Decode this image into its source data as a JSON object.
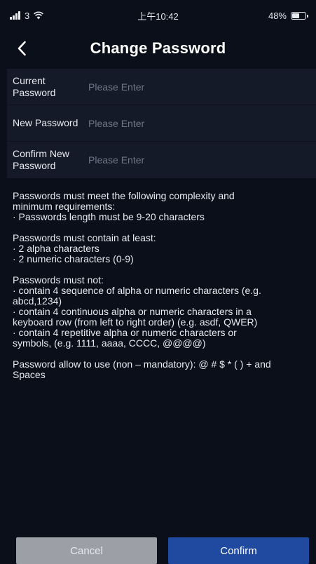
{
  "status_bar": {
    "carrier": "3",
    "time": "上午10:42",
    "battery_text": "48%",
    "battery_level": 0.48
  },
  "header": {
    "back_icon": "chevron-left-icon",
    "title": "Change Password"
  },
  "form": {
    "current_label": "Current Password",
    "current_placeholder": "Please Enter",
    "new_label": "New Password",
    "new_placeholder": "Please Enter",
    "confirm_label": "Confirm New Password",
    "confirm_placeholder": "Please Enter"
  },
  "requirements": {
    "block1": [
      "Passwords must meet the following complexity and",
      "minimum requirements:",
      "· Passwords length must be 9-20 characters"
    ],
    "block2": [
      "Passwords must contain at least:",
      "· 2 alpha characters",
      "· 2 numeric characters (0-9)"
    ],
    "block3": [
      "Passwords must not:",
      "· contain 4 sequence of alpha or numeric characters (e.g.",
      "abcd,1234)",
      "· contain 4 continuous alpha or numeric characters in a",
      "keyboard row (from left to right order) (e.g. asdf, QWER)",
      "· contain 4 repetitive alpha or numeric characters or",
      "symbols, (e.g. 1111, aaaa, CCCC, @@@@)"
    ],
    "block4": [
      "Password allow to use (non – mandatory): @ # $ * ( ) + and",
      "Spaces"
    ]
  },
  "buttons": {
    "cancel_label": "Cancel",
    "confirm_label": "Confirm"
  },
  "colors": {
    "background": "#0b0f1a",
    "form_background": "#141a27",
    "cancel_button": "#9c9fa6",
    "confirm_button": "#1f4aa0"
  }
}
